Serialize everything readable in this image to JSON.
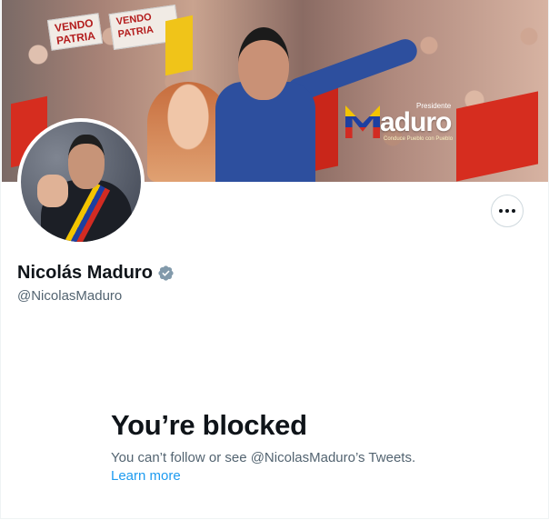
{
  "banner": {
    "sign_left": "VENDO PATRIA",
    "brand_word": "aduro",
    "brand_small": "Presidente",
    "brand_tag": "Conduce Pueblo con Pueblo"
  },
  "profile": {
    "name": "Nicolás Maduro",
    "handle": "@NicolasMaduro",
    "verified": true
  },
  "actions": {
    "more_icon": "ellipsis-icon"
  },
  "blocked": {
    "title": "You’re blocked",
    "message": "You can’t follow or see @NicolasMaduro’s Tweets.",
    "link_label": "Learn more"
  },
  "colors": {
    "text": "#0f1419",
    "secondary": "#536471",
    "link": "#1d9bf0",
    "verified": "#829aab",
    "border": "#cfd9de"
  }
}
